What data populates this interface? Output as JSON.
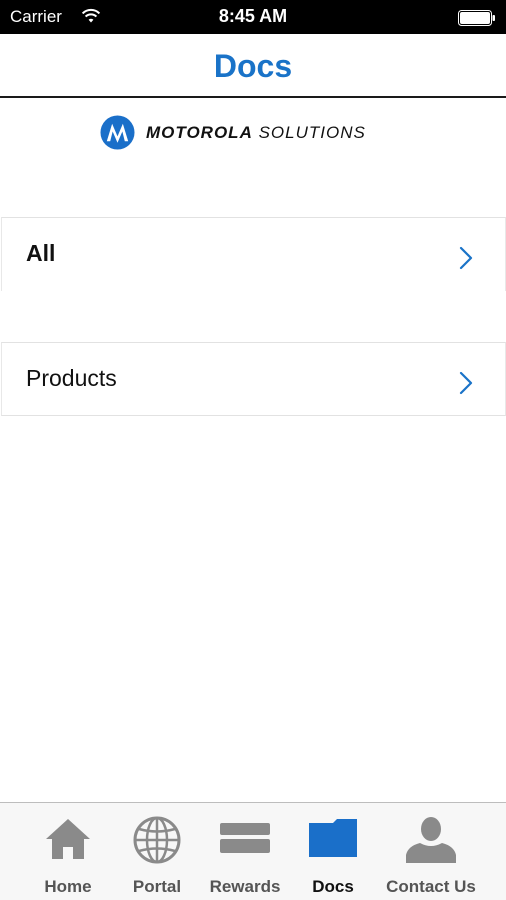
{
  "status_bar": {
    "carrier": "Carrier",
    "time": "8:45 AM"
  },
  "nav": {
    "title": "Docs"
  },
  "logo": {
    "brand_bold": "MOTOROLA",
    "brand_light": "SOLUTIONS"
  },
  "list": {
    "items": [
      {
        "label": "All",
        "icon": "chevron-right-icon"
      },
      {
        "label": "Products",
        "icon": "chevron-right-icon"
      }
    ]
  },
  "tab_bar": {
    "tabs": [
      {
        "label": "Home",
        "icon": "home-icon"
      },
      {
        "label": "Portal",
        "icon": "globe-icon"
      },
      {
        "label": "Rewards",
        "icon": "card-icon"
      },
      {
        "label": "Docs",
        "icon": "folder-icon",
        "active": true
      },
      {
        "label": "Contact Us",
        "icon": "person-icon"
      }
    ]
  },
  "colors": {
    "accent": "#1a73c8",
    "tab_inactive_icon": "#8a8a8a",
    "tab_active_icon": "#1a6fc9"
  }
}
